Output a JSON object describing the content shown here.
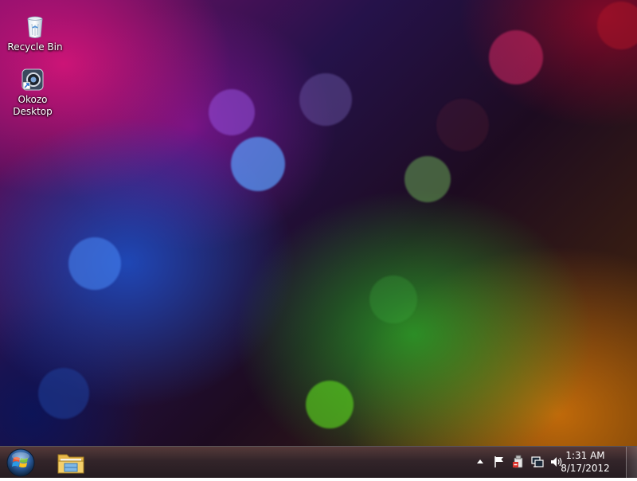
{
  "desktop": {
    "icons": [
      {
        "label": "Recycle Bin",
        "icon": "recycle-bin-icon"
      },
      {
        "label": "Okozo Desktop",
        "icon": "okozo-desktop-icon"
      }
    ]
  },
  "taskbar": {
    "start_icon": "windows-start-orb-icon",
    "pinned": [
      {
        "icon": "windows-explorer-folder-icon"
      }
    ],
    "tray": {
      "icons": [
        "show-hidden-icons-arrow-icon",
        "action-center-flag-icon",
        "safely-remove-hardware-icon",
        "network-icon",
        "volume-speaker-icon"
      ],
      "time": "1:31 AM",
      "date": "8/17/2012"
    }
  },
  "colors": {
    "taskbar": "#2a1a1f",
    "text": "#ffffff"
  }
}
